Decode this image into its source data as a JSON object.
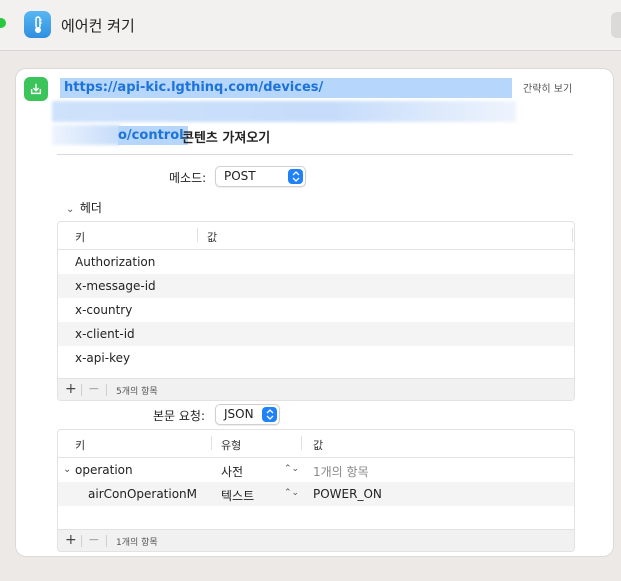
{
  "window": {
    "title": "에어컨 켜기"
  },
  "action": {
    "url_part1": "https://api-kic.lgthinq.com/devices/",
    "url_part3": "o/control",
    "label": "콘텐츠 가져오기",
    "simple_view": "간략히 보기"
  },
  "method": {
    "label": "메소드:",
    "value": "POST"
  },
  "headers": {
    "label": "헤더",
    "col_key": "키",
    "col_value": "값",
    "rows": [
      "Authorization",
      "x-message-id",
      "x-country",
      "x-client-id",
      "x-api-key"
    ],
    "count": "5개의 항목"
  },
  "body": {
    "label": "본문 요청:",
    "value": "JSON",
    "col_key": "키",
    "col_type": "유형",
    "col_value": "값",
    "rows": [
      {
        "key": "operation",
        "type": "사전",
        "value": "1개의 항목"
      },
      {
        "key": "airConOperationM",
        "type": "텍스트",
        "value": "POWER_ON"
      }
    ],
    "count": "1개의 항목"
  },
  "colors": {
    "accent": "#1f82f7",
    "action_green": "#3bc45a",
    "app_blue": "#3a9cec",
    "highlight": "#b6d6fb"
  }
}
